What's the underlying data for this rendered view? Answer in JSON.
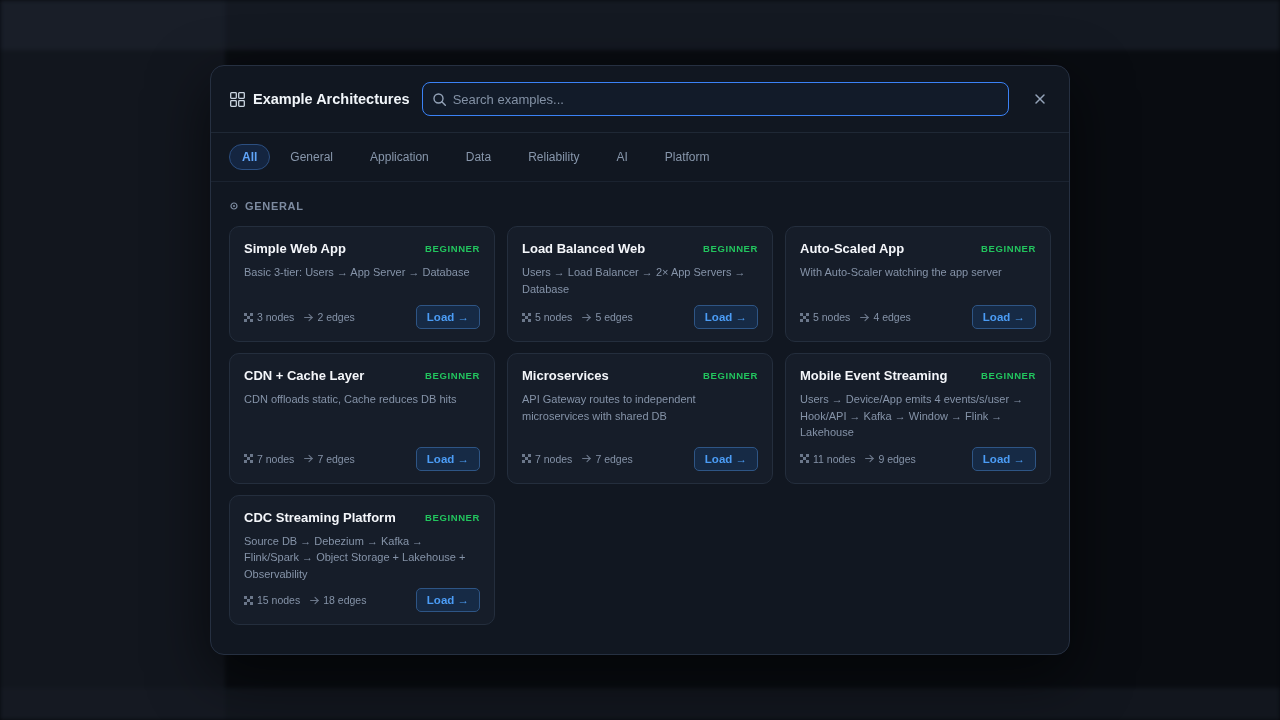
{
  "dialog": {
    "title": "Example Architectures",
    "search": {
      "placeholder": "Search examples..."
    },
    "filters": [
      {
        "label": "All",
        "selected": true
      },
      {
        "label": "General",
        "selected": false
      },
      {
        "label": "Application",
        "selected": false
      },
      {
        "label": "Data",
        "selected": false
      },
      {
        "label": "Reliability",
        "selected": false
      },
      {
        "label": "AI",
        "selected": false
      },
      {
        "label": "Platform",
        "selected": false
      }
    ],
    "sections": [
      {
        "heading": "GENERAL",
        "examples": [
          {
            "title": "Simple Web App",
            "badge": "BEGINNER",
            "description": "Basic 3-tier: Users → App Server → Database",
            "nodes": "3 nodes",
            "edges": "2 edges",
            "button": "Load →"
          },
          {
            "title": "Load Balanced Web",
            "badge": "BEGINNER",
            "description": "Users → Load Balancer → 2× App Servers → Database",
            "nodes": "5 nodes",
            "edges": "5 edges",
            "button": "Load →"
          },
          {
            "title": "Auto-Scaled App",
            "badge": "BEGINNER",
            "description": "With Auto-Scaler watching the app server",
            "nodes": "5 nodes",
            "edges": "4 edges",
            "button": "Load →"
          },
          {
            "title": "CDN + Cache Layer",
            "badge": "BEGINNER",
            "description": "CDN offloads static, Cache reduces DB hits",
            "nodes": "7 nodes",
            "edges": "7 edges",
            "button": "Load →"
          },
          {
            "title": "Microservices",
            "badge": "BEGINNER",
            "description": "API Gateway routes to independent microservices with shared DB",
            "nodes": "7 nodes",
            "edges": "7 edges",
            "button": "Load →"
          },
          {
            "title": "Mobile Event Streaming",
            "badge": "BEGINNER",
            "description": "Users → Device/App emits 4 events/s/user → Hook/API → Kafka → Window → Flink → Lakehouse",
            "nodes": "11 nodes",
            "edges": "9 edges",
            "button": "Load →"
          },
          {
            "title": "CDC Streaming Platform",
            "badge": "BEGINNER",
            "description": "Source DB → Debezium → Kafka → Flink/Spark → Object Storage + Lakehouse + Observability",
            "nodes": "15 nodes",
            "edges": "18 edges",
            "button": "Load →"
          }
        ]
      }
    ]
  }
}
